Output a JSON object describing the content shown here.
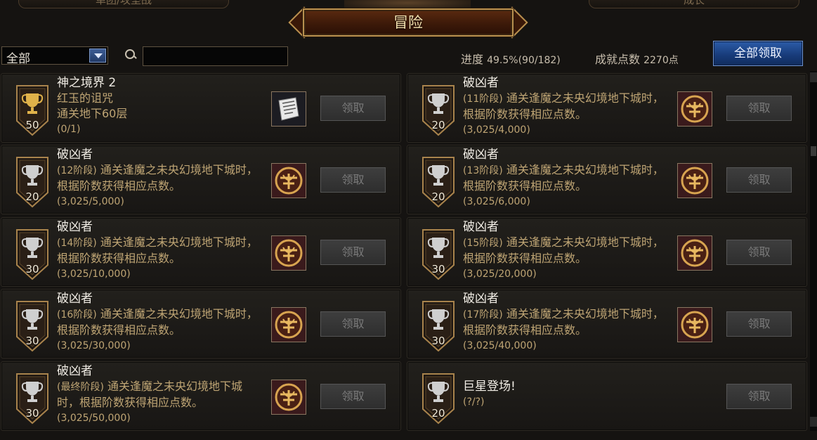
{
  "header": {
    "left_tab": "单团/攻坚战",
    "right_tab": "成长",
    "title": "冒险"
  },
  "filter": {
    "selected": "全部",
    "search_value": "",
    "progress_label": "进度",
    "progress_value": "49.5%(90/182)",
    "points_label": "成就点数",
    "points_value": "2270点",
    "claim_all_label": "全部领取"
  },
  "colors": {
    "accent_blue": "#1f4a94",
    "desc_gold": "#bfa574",
    "disabled_button": "#3a3a3a"
  },
  "achievements": [
    {
      "name": "神之境界 2",
      "desc": "红玉的诅咒",
      "desc2": "通关地下60层",
      "progress": "(0/1)",
      "points": "50",
      "reward_icon": "scroll-icon",
      "claim_label": "领取"
    },
    {
      "name": "破凶者",
      "stage": "(11阶段)",
      "desc": " 通关逢魔之未央幻境地下城时，根据阶数获得相应点数。",
      "progress": "(3,025/4,000)",
      "points": "20",
      "reward_icon": "emblem-icon",
      "claim_label": "领取"
    },
    {
      "name": "破凶者",
      "stage": "(12阶段)",
      "desc": " 通关逢魔之未央幻境地下城时，根据阶数获得相应点数。",
      "progress": "(3,025/5,000)",
      "points": "20",
      "reward_icon": "emblem-icon",
      "claim_label": "领取"
    },
    {
      "name": "破凶者",
      "stage": "(13阶段)",
      "desc": " 通关逢魔之未央幻境地下城时，根据阶数获得相应点数。",
      "progress": "(3,025/6,000)",
      "points": "20",
      "reward_icon": "emblem-icon",
      "claim_label": "领取"
    },
    {
      "name": "破凶者",
      "stage": "(14阶段)",
      "desc": " 通关逢魔之未央幻境地下城时，根据阶数获得相应点数。",
      "progress": "(3,025/10,000)",
      "points": "30",
      "reward_icon": "emblem-icon",
      "claim_label": "领取"
    },
    {
      "name": "破凶者",
      "stage": "(15阶段)",
      "desc": " 通关逢魔之未央幻境地下城时，根据阶数获得相应点数。",
      "progress": "(3,025/20,000)",
      "points": "30",
      "reward_icon": "emblem-icon",
      "claim_label": "领取"
    },
    {
      "name": "破凶者",
      "stage": "(16阶段)",
      "desc": " 通关逢魔之未央幻境地下城时，根据阶数获得相应点数。",
      "progress": "(3,025/30,000)",
      "points": "30",
      "reward_icon": "emblem-icon",
      "claim_label": "领取"
    },
    {
      "name": "破凶者",
      "stage": "(17阶段)",
      "desc": " 通关逢魔之未央幻境地下城时，根据阶数获得相应点数。",
      "progress": "(3,025/40,000)",
      "points": "30",
      "reward_icon": "emblem-icon",
      "claim_label": "领取"
    },
    {
      "name": "破凶者",
      "stage": "(最终阶段)",
      "desc": " 通关逢魔之未央幻境地下城时，根据阶数获得相应点数。",
      "progress": "(3,025/50,000)",
      "points": "30",
      "reward_icon": "emblem-icon",
      "claim_label": "领取"
    },
    {
      "name": "巨星登场!",
      "progress": "(?/?)",
      "points": "20",
      "reward_icon": "",
      "claim_label": "领取"
    }
  ]
}
